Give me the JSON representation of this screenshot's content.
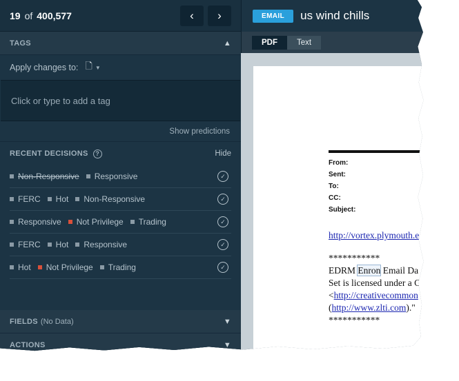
{
  "nav": {
    "current": "19",
    "of": "of",
    "total": "400,577",
    "prev_icon": "‹",
    "next_icon": "›"
  },
  "tags": {
    "title": "TAGS",
    "apply_label": "Apply changes to:",
    "input_placeholder": "Click or type to add a tag",
    "show_predictions": "Show predictions"
  },
  "recent": {
    "title": "RECENT DECISIONS",
    "help": "?",
    "hide": "Hide",
    "rows": [
      {
        "tags": [
          {
            "label": "Non-Responsive",
            "color": "#8a9aa5",
            "struck": true
          },
          {
            "label": "Responsive",
            "color": "#8a9aa5"
          }
        ]
      },
      {
        "tags": [
          {
            "label": "FERC",
            "color": "#8a9aa5"
          },
          {
            "label": "Hot",
            "color": "#8a9aa5"
          },
          {
            "label": "Non-Responsive",
            "color": "#8a9aa5"
          }
        ]
      },
      {
        "tags": [
          {
            "label": "Responsive",
            "color": "#8a9aa5"
          },
          {
            "label": "Not Privilege",
            "color": "#d9503a"
          },
          {
            "label": "Trading",
            "color": "#8a9aa5"
          }
        ]
      },
      {
        "tags": [
          {
            "label": "FERC",
            "color": "#8a9aa5"
          },
          {
            "label": "Hot",
            "color": "#8a9aa5"
          },
          {
            "label": "Responsive",
            "color": "#8a9aa5"
          }
        ]
      },
      {
        "tags": [
          {
            "label": "Hot",
            "color": "#8a9aa5"
          },
          {
            "label": "Not Privilege",
            "color": "#d9503a"
          },
          {
            "label": "Trading",
            "color": "#8a9aa5"
          }
        ]
      }
    ]
  },
  "fields": {
    "title": "FIELDS",
    "note": "(No Data)"
  },
  "actions": {
    "title": "ACTIONS"
  },
  "viewer": {
    "badge": "EMAIL",
    "subject": "us wind chills",
    "tab_pdf": "PDF",
    "tab_text": "Text",
    "header_fields": [
      "From:",
      "Sent:",
      "To:",
      "CC:",
      "Subject:"
    ],
    "link1": "http://vortex.plymouth.e",
    "stars": "***********",
    "line1_a": "EDRM ",
    "line1_hl": "Enron",
    "line1_b": " Email Da",
    "line2": "Set is licensed under a C",
    "line3_pre": "<",
    "line3_link": "http://creativecommon",
    "line4_pre": "(",
    "line4_link": "http://www.zlti.com",
    "line4_post": ").\"",
    "stars2": "***********"
  },
  "colors": {
    "accent": "#2aa0dc",
    "not_privilege": "#d9503a",
    "panel": "#1c3444"
  }
}
